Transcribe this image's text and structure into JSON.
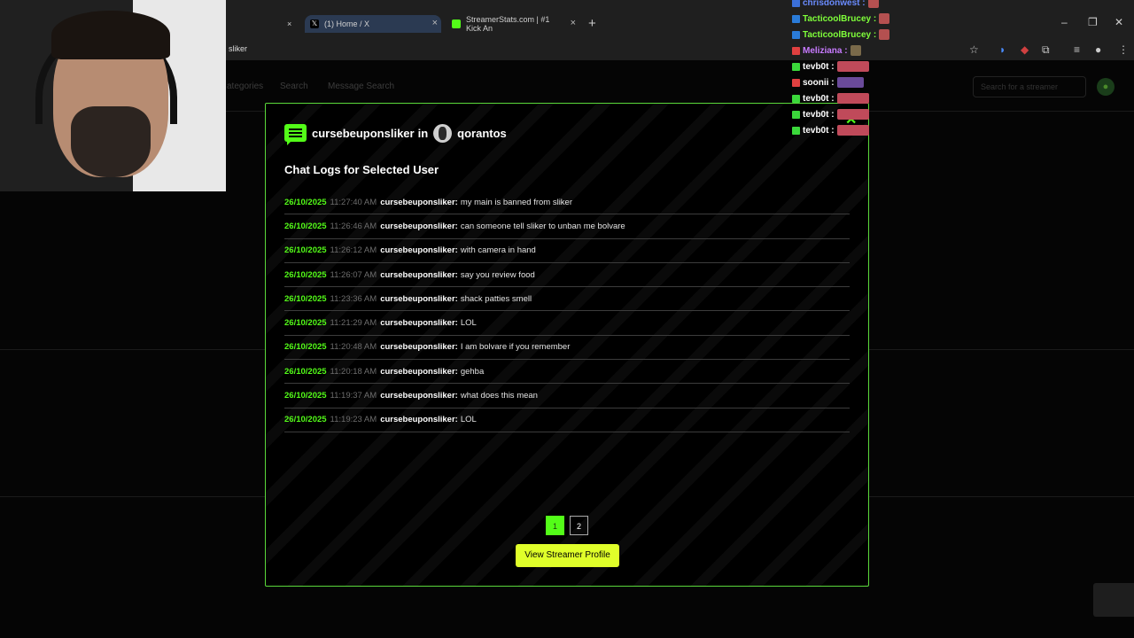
{
  "browser": {
    "tabs": [
      {
        "label": "(1) Home / X",
        "active": true
      },
      {
        "label": "StreamerStats.com | #1 Kick An",
        "active": false
      }
    ],
    "new_tab": "+",
    "url_fragment": "sliker",
    "window_controls": [
      "–",
      "❐",
      "✕"
    ]
  },
  "site": {
    "nav": [
      "ategories",
      "Search",
      "Message Search"
    ],
    "search_placeholder": "Search for a streamer"
  },
  "modal": {
    "user": "cursebeuponsliker",
    "in_label": "in",
    "streamer": "qorantos",
    "subtitle": "Chat Logs for Selected User",
    "logs": [
      {
        "date": "26/10/2025",
        "time": "11:27:40 AM",
        "user": "cursebeuponsliker:",
        "message": "my main is banned from sliker"
      },
      {
        "date": "26/10/2025",
        "time": "11:26:46 AM",
        "user": "cursebeuponsliker:",
        "message": "can someone tell sliker to unban me bolvare"
      },
      {
        "date": "26/10/2025",
        "time": "11:26:12 AM",
        "user": "cursebeuponsliker:",
        "message": "with camera in hand"
      },
      {
        "date": "26/10/2025",
        "time": "11:26:07 AM",
        "user": "cursebeuponsliker:",
        "message": "say you review food"
      },
      {
        "date": "26/10/2025",
        "time": "11:23:36 AM",
        "user": "cursebeuponsliker:",
        "message": "shack patties smell"
      },
      {
        "date": "26/10/2025",
        "time": "11:21:29 AM",
        "user": "cursebeuponsliker:",
        "message": "LOL"
      },
      {
        "date": "26/10/2025",
        "time": "11:20:48 AM",
        "user": "cursebeuponsliker:",
        "message": "I am bolvare if you remember"
      },
      {
        "date": "26/10/2025",
        "time": "11:20:18 AM",
        "user": "cursebeuponsliker:",
        "message": "gehba"
      },
      {
        "date": "26/10/2025",
        "time": "11:19:37 AM",
        "user": "cursebeuponsliker:",
        "message": "what does this mean"
      },
      {
        "date": "26/10/2025",
        "time": "11:19:23 AM",
        "user": "cursebeuponsliker:",
        "message": "LOL"
      }
    ],
    "pages": [
      "1",
      "2"
    ],
    "current_page": "1",
    "view_button": "View Streamer Profile",
    "close": "✕"
  },
  "chat_overlay": [
    {
      "name": "chrisdonwest :",
      "color": "#6a8cff",
      "badge": "#3b6fd8"
    },
    {
      "name": "TacticoolBrucey :",
      "color": "#7fff3a",
      "badge": "#2a7bd8"
    },
    {
      "name": "TacticoolBrucey :",
      "color": "#7fff3a",
      "badge": "#2a7bd8"
    },
    {
      "name": "Meliziana :",
      "color": "#c87bff",
      "badge": "#e04040"
    },
    {
      "name": "tevb0t :",
      "color": "#ffffff",
      "badge": "#3bd83b"
    },
    {
      "name": "soonii :",
      "color": "#ffffff",
      "badge": "#e04040"
    },
    {
      "name": "tevb0t :",
      "color": "#ffffff",
      "badge": "#3bd83b"
    },
    {
      "name": "tevb0t :",
      "color": "#ffffff",
      "badge": "#3bd83b"
    },
    {
      "name": "tevb0t :",
      "color": "#ffffff",
      "badge": "#3bd83b"
    }
  ],
  "colors": {
    "accent": "#53fc18",
    "button": "#e0ff2a"
  }
}
